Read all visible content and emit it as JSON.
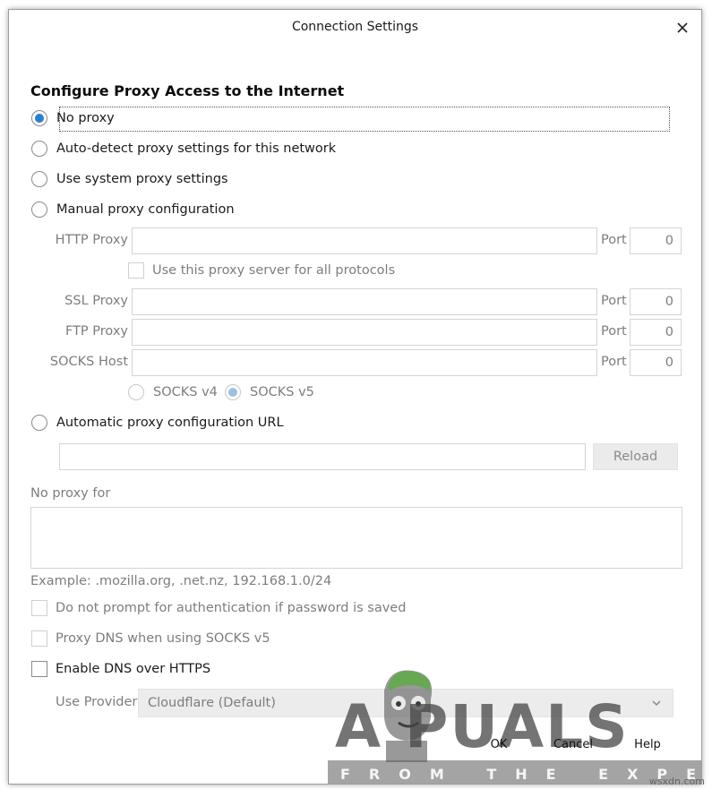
{
  "window": {
    "title": "Connection Settings"
  },
  "section": {
    "heading": "Configure Proxy Access to the Internet"
  },
  "proxy_options": [
    {
      "label": "No proxy",
      "checked": true
    },
    {
      "label": "Auto-detect proxy settings for this network",
      "checked": false
    },
    {
      "label": "Use system proxy settings",
      "checked": false
    },
    {
      "label": "Manual proxy configuration",
      "checked": false
    }
  ],
  "manual": {
    "http_label": "HTTP Proxy",
    "http_port_label": "Port",
    "http_port": "0",
    "use_all_label": "Use this proxy server for all protocols",
    "ssl_label": "SSL Proxy",
    "ssl_port_label": "Port",
    "ssl_port": "0",
    "ftp_label": "FTP Proxy",
    "ftp_port_label": "Port",
    "ftp_port": "0",
    "socks_label": "SOCKS Host",
    "socks_port_label": "Port",
    "socks_port": "0",
    "socks_v4_label": "SOCKS v4",
    "socks_v5_label": "SOCKS v5"
  },
  "auto_url": {
    "label": "Automatic proxy configuration URL",
    "reload_label": "Reload"
  },
  "no_proxy": {
    "label": "No proxy for",
    "example": "Example: .mozilla.org, .net.nz, 192.168.1.0/24"
  },
  "options": {
    "no_prompt_label": "Do not prompt for authentication if password is saved",
    "proxy_dns_label": "Proxy DNS when using SOCKS v5",
    "enable_dns_label": "Enable DNS over HTTPS",
    "provider_label": "Use Provider",
    "provider_value": "Cloudflare (Default)"
  },
  "footer": {
    "ok": "OK",
    "cancel": "Cancel",
    "help": "Help"
  },
  "watermark": {
    "brand": "A  PUALS",
    "tagline": "FROM THE EXPERTS!",
    "site": "wsxdn.com"
  },
  "colors": {
    "accent": "#2a7fd5",
    "disabled_text": "#7d7d7d"
  }
}
